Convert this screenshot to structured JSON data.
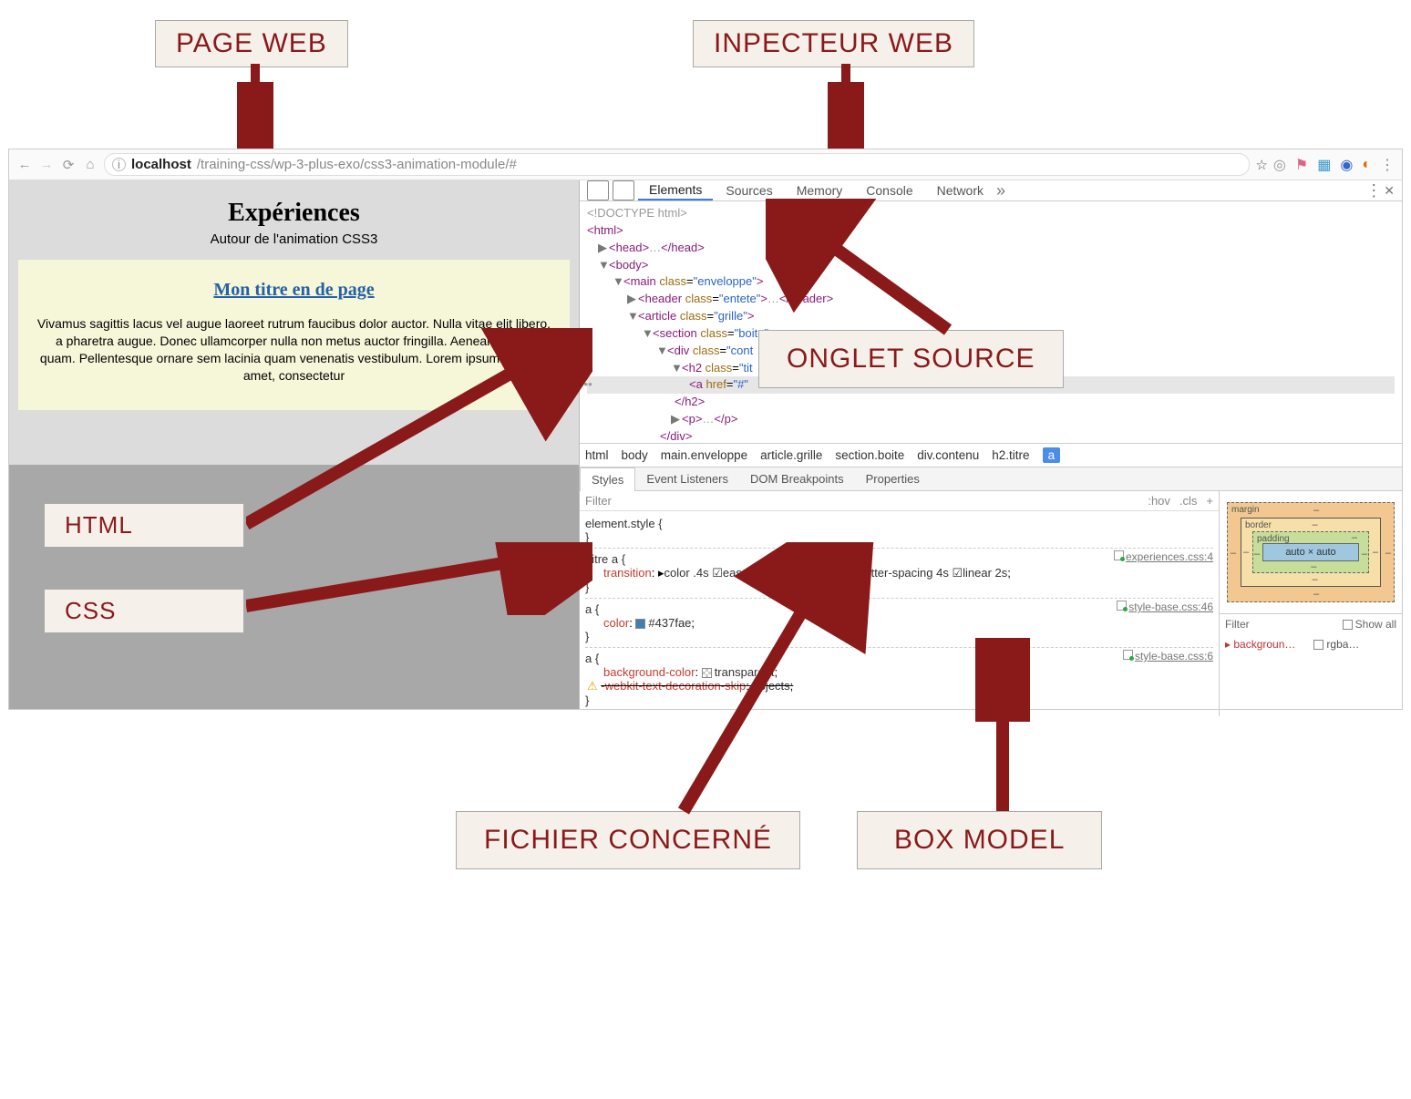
{
  "annotations": {
    "page_web": "PAGE WEB",
    "inspecteur": "INPECTEUR WEB",
    "onglet_source": "ONGLET SOURCE",
    "html": "HTML",
    "css": "CSS",
    "fichier": "FICHIER CONCERNÉ",
    "box_model": "BOX MODEL"
  },
  "browser": {
    "url_host": "localhost",
    "url_path": "/training-css/wp-3-plus-exo/css3-animation-module/#",
    "star": "☆"
  },
  "page": {
    "title": "Expériences",
    "subtitle": "Autour de l'animation CSS3",
    "card_link": "Mon titre en de page",
    "card_text": "Vivamus sagittis lacus vel augue laoreet rutrum faucibus dolor auctor. Nulla vitae elit libero, a pharetra augue. Donec ullamcorper nulla non metus auctor fringilla. Aenean eu leo quam. Pellentesque ornare sem lacinia quam venenatis vestibulum. Lorem ipsum dolor sit amet, consectetur"
  },
  "devtools": {
    "tabs": [
      "Elements",
      "Sources",
      "Memory",
      "Console",
      "Network"
    ],
    "more": "»",
    "dom": {
      "doctype": "<!DOCTYPE html>",
      "html": "html",
      "head": "head",
      "body": "body",
      "main_class": "enveloppe",
      "header_class": "entete",
      "article_class": "grille",
      "section_class": "boite",
      "div_class": "contenu",
      "h2_class": "titre",
      "a_href": "#",
      "ellipsis": "…"
    },
    "breadcrumb": [
      "html",
      "body",
      "main.enveloppe",
      "article.grille",
      "section.boite",
      "div.contenu",
      "h2.titre",
      "a"
    ],
    "subtabs": [
      "Styles",
      "Event Listeners",
      "DOM Breakpoints",
      "Properties"
    ],
    "filter": {
      "label": "Filter",
      "hov": ":hov",
      "cls": ".cls",
      "plus": "+"
    },
    "rules": {
      "elstyle": "element.style {",
      "r1_sel": ".titre a {",
      "r1_src": "experiences.css:4",
      "r1_prop": "transition",
      "r1_val": "color .4s ☑ease, font-size 3s ☑ease, letter-spacing 4s ☑linear 2s",
      "r2_sel": "a {",
      "r2_src": "style-base.css:46",
      "r2_prop": "color",
      "r2_val": "#437fae",
      "r3_sel": "a {",
      "r3_src": "style-base.css:6",
      "r3_prop1": "background-color",
      "r3_val1": "transparent",
      "r3_prop2": "-webkit-text-decoration-skip",
      "r3_val2": "objects",
      "close": "}"
    },
    "boxmodel": {
      "margin": "margin",
      "border": "border",
      "padding": "padding",
      "content": "auto × auto"
    },
    "computed": {
      "filter": "Filter",
      "showall": "Show all",
      "bg": "backgroun…",
      "rgba": "rgba…"
    }
  }
}
